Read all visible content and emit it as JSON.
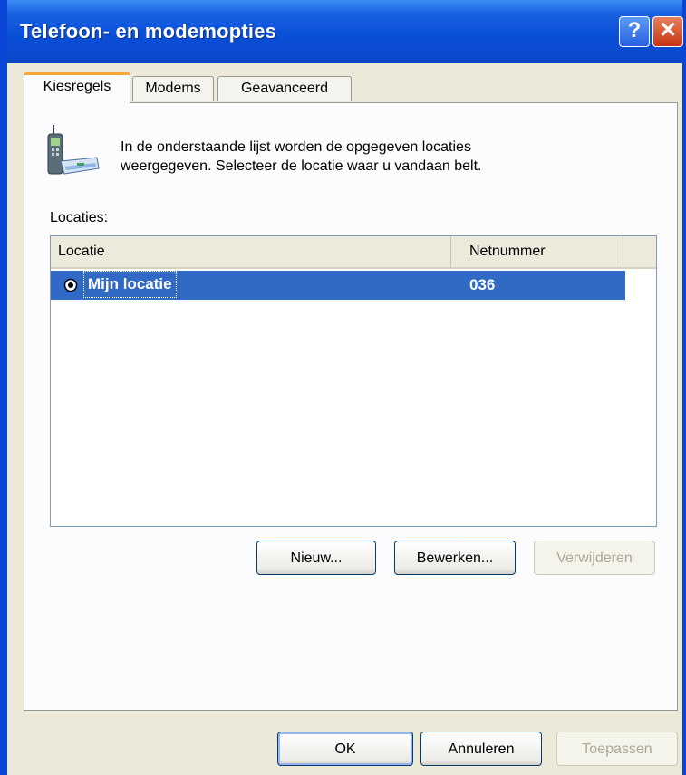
{
  "window": {
    "title": "Telefoon- en modemopties",
    "help_glyph": "?",
    "close_glyph": "✕"
  },
  "tabs": [
    {
      "label": "Kiesregels",
      "active": true
    },
    {
      "label": "Modems",
      "active": false
    },
    {
      "label": "Geavanceerd",
      "active": false
    }
  ],
  "panel": {
    "icon": "phone-modem-icon",
    "info_line1": "In de onderstaande lijst worden de opgegeven locaties",
    "info_line2": "weergegeven. Selecteer de locatie waar u vandaan belt.",
    "locations_label": "Locaties:",
    "columns": [
      "Locatie",
      "Netnummer"
    ],
    "rows": [
      {
        "name": "Mijn locatie",
        "code": "036",
        "selected": true
      }
    ],
    "buttons": {
      "new": "Nieuw...",
      "edit": "Bewerken...",
      "delete": "Verwijderen"
    }
  },
  "footer": {
    "ok": "OK",
    "cancel": "Annuleren",
    "apply": "Toepassen"
  },
  "colors": {
    "titlebar": "#0A4FD8",
    "selection": "#316AC5",
    "tab_highlight": "#F7A73A"
  }
}
